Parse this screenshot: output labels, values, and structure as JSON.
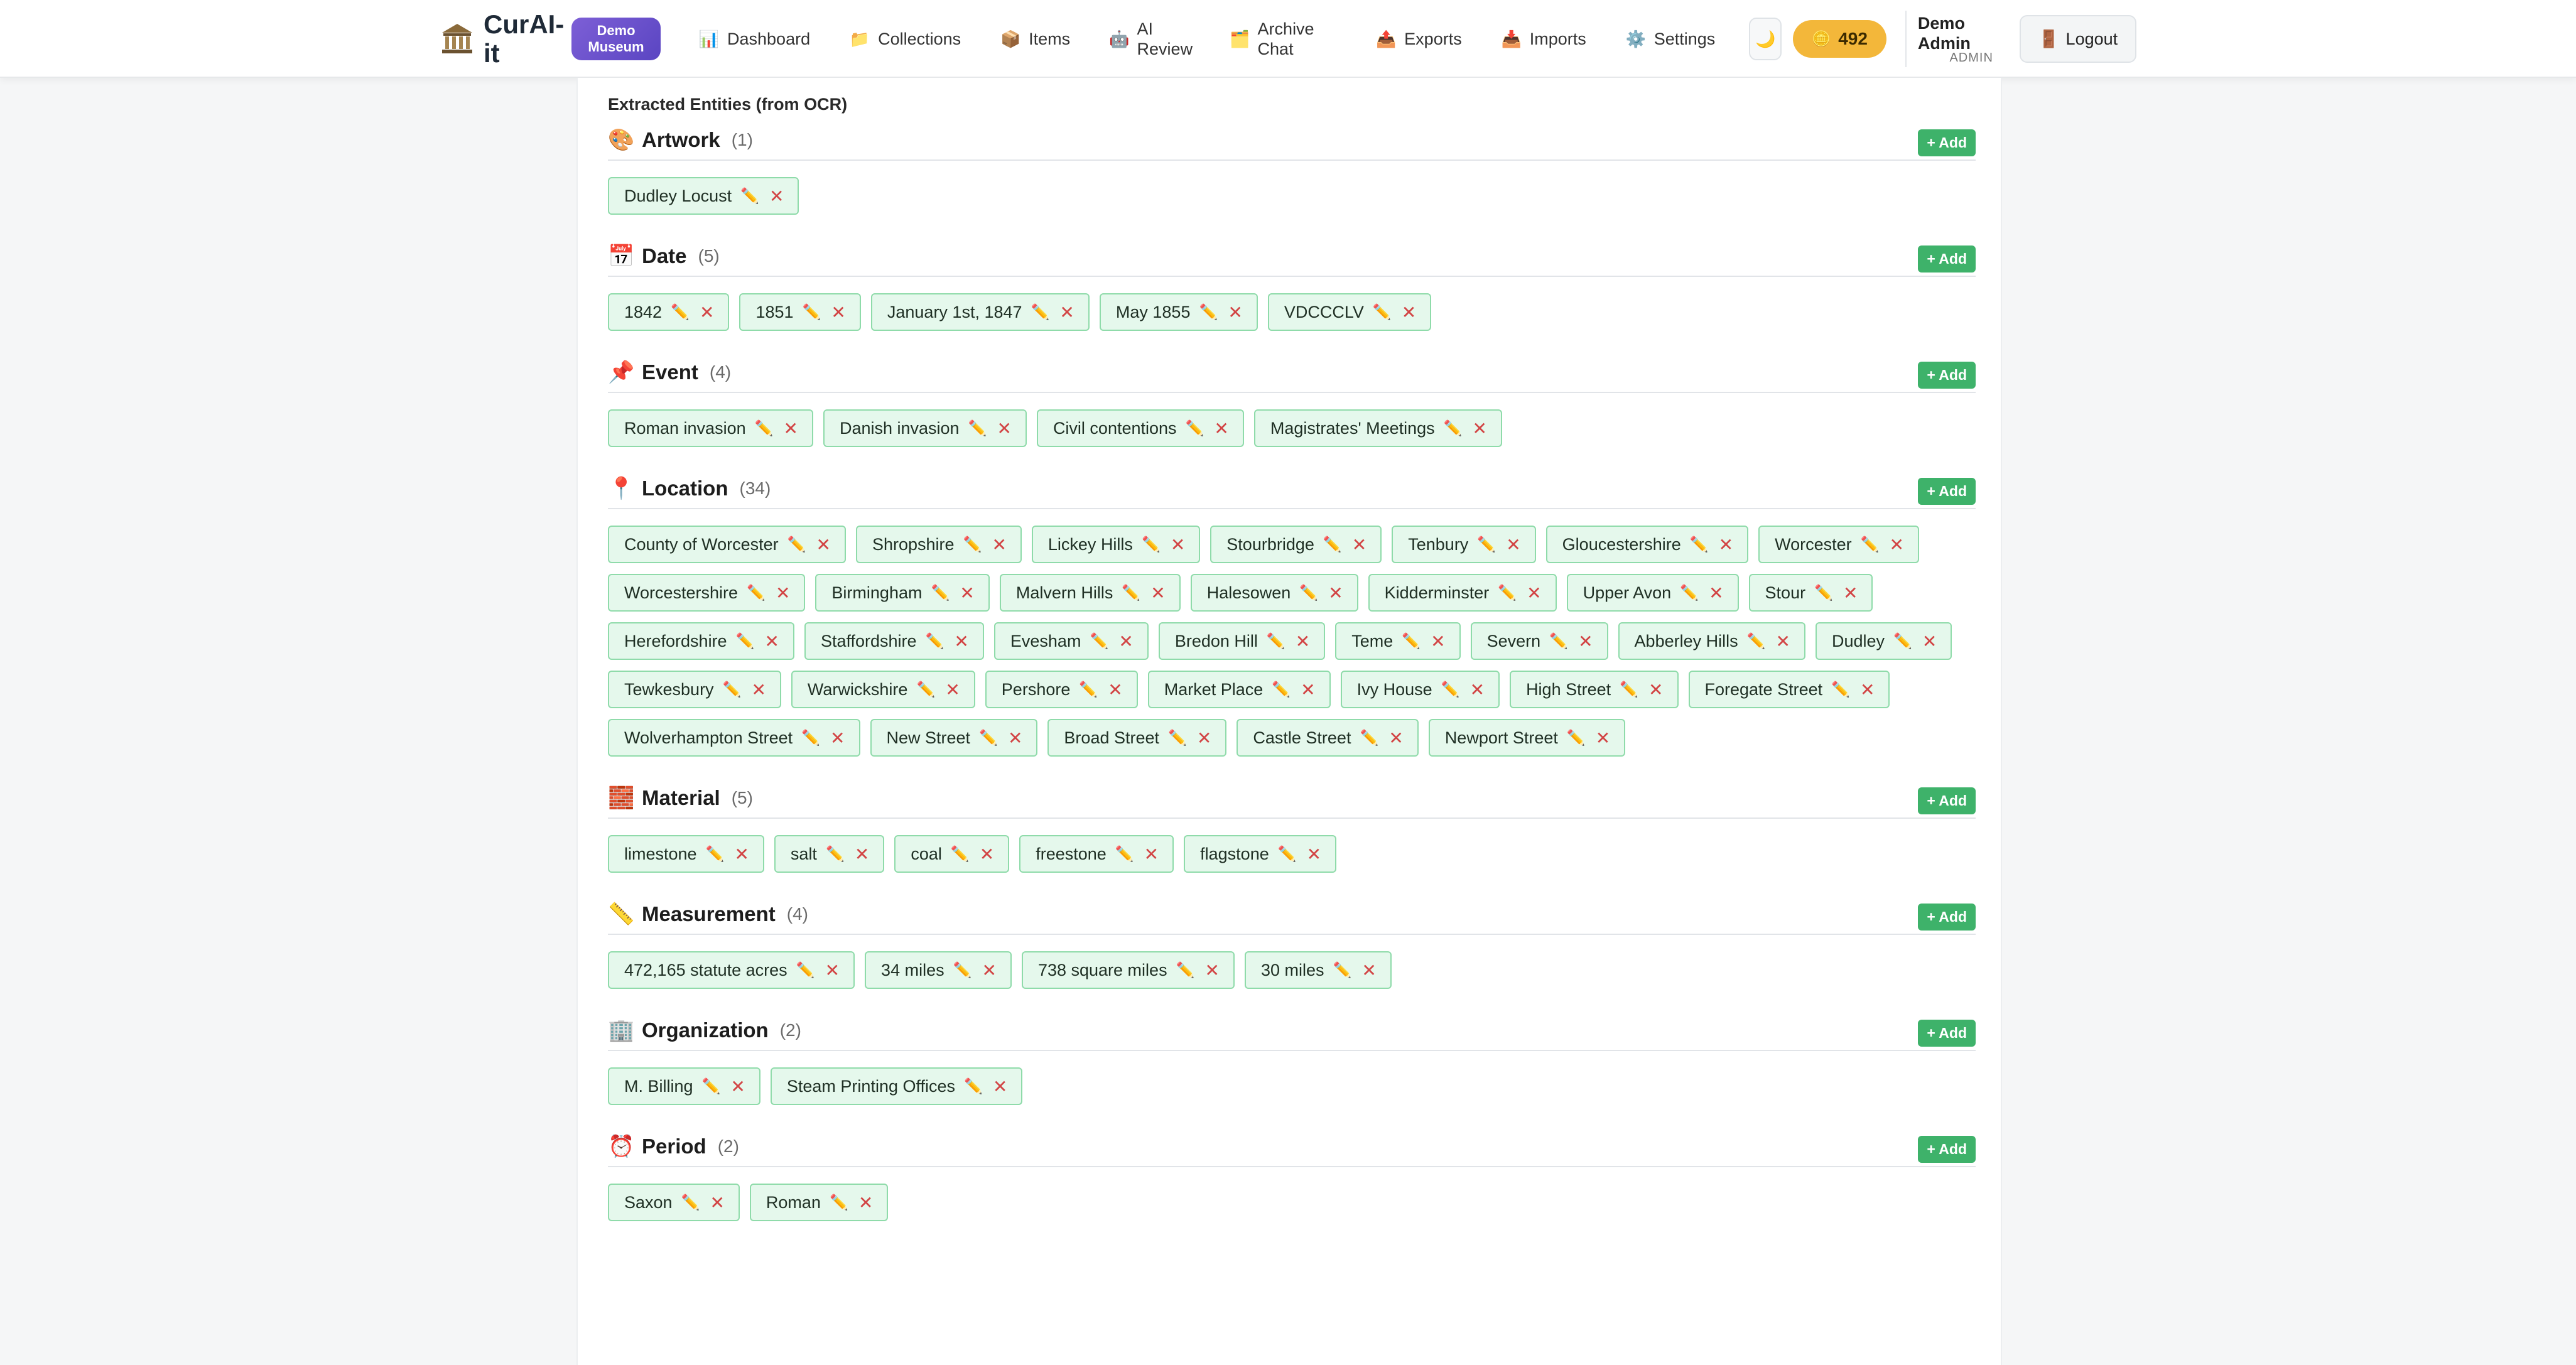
{
  "brand": {
    "name": "CurAI-it",
    "museum_badge": "Demo Museum"
  },
  "nav": [
    {
      "label": "Dashboard",
      "icon": "📊"
    },
    {
      "label": "Collections",
      "icon": "📁"
    },
    {
      "label": "Items",
      "icon": "📦"
    },
    {
      "label": "AI Review",
      "icon": "🤖"
    },
    {
      "label": "Archive Chat",
      "icon": "🗂️"
    },
    {
      "label": "Exports",
      "icon": "📤"
    },
    {
      "label": "Imports",
      "icon": "📥"
    },
    {
      "label": "Settings",
      "icon": "⚙️"
    }
  ],
  "header": {
    "theme_icon": "🌙",
    "credits": "492",
    "credits_icon": "🪙",
    "user_name": "Demo Admin",
    "user_role": "ADMIN",
    "logout_label": "Logout",
    "logout_icon": "🚪"
  },
  "section_title": "Extracted Entities (from OCR)",
  "add_label": "+ Add",
  "groups": [
    {
      "name": "Artwork",
      "count": "(1)",
      "icon": "🎨",
      "items": [
        "Dudley Locust"
      ]
    },
    {
      "name": "Date",
      "count": "(5)",
      "icon": "📅",
      "items": [
        "1842",
        "1851",
        "January 1st, 1847",
        "May 1855",
        "VDCCCLV"
      ]
    },
    {
      "name": "Event",
      "count": "(4)",
      "icon": "📌",
      "items": [
        "Roman invasion",
        "Danish invasion",
        "Civil contentions",
        "Magistrates' Meetings"
      ]
    },
    {
      "name": "Location",
      "count": "(34)",
      "icon": "📍",
      "items": [
        "County of Worcester",
        "Shropshire",
        "Lickey Hills",
        "Stourbridge",
        "Tenbury",
        "Gloucestershire",
        "Worcester",
        "Worcestershire",
        "Birmingham",
        "Malvern Hills",
        "Halesowen",
        "Kidderminster",
        "Upper Avon",
        "Stour",
        "Herefordshire",
        "Staffordshire",
        "Evesham",
        "Bredon Hill",
        "Teme",
        "Severn",
        "Abberley Hills",
        "Dudley",
        "Tewkesbury",
        "Warwickshire",
        "Pershore",
        "Market Place",
        "Ivy House",
        "High Street",
        "Foregate Street",
        "Wolverhampton Street",
        "New Street",
        "Broad Street",
        "Castle Street",
        "Newport Street"
      ]
    },
    {
      "name": "Material",
      "count": "(5)",
      "icon": "🧱",
      "items": [
        "limestone",
        "salt",
        "coal",
        "freestone",
        "flagstone"
      ]
    },
    {
      "name": "Measurement",
      "count": "(4)",
      "icon": "📏",
      "items": [
        "472,165 statute acres",
        "34 miles",
        "738 square miles",
        "30 miles"
      ]
    },
    {
      "name": "Organization",
      "count": "(2)",
      "icon": "🏢",
      "items": [
        "M. Billing",
        "Steam Printing Offices"
      ]
    },
    {
      "name": "Period",
      "count": "(2)",
      "icon": "⏰",
      "items": [
        "Saxon",
        "Roman"
      ]
    }
  ]
}
